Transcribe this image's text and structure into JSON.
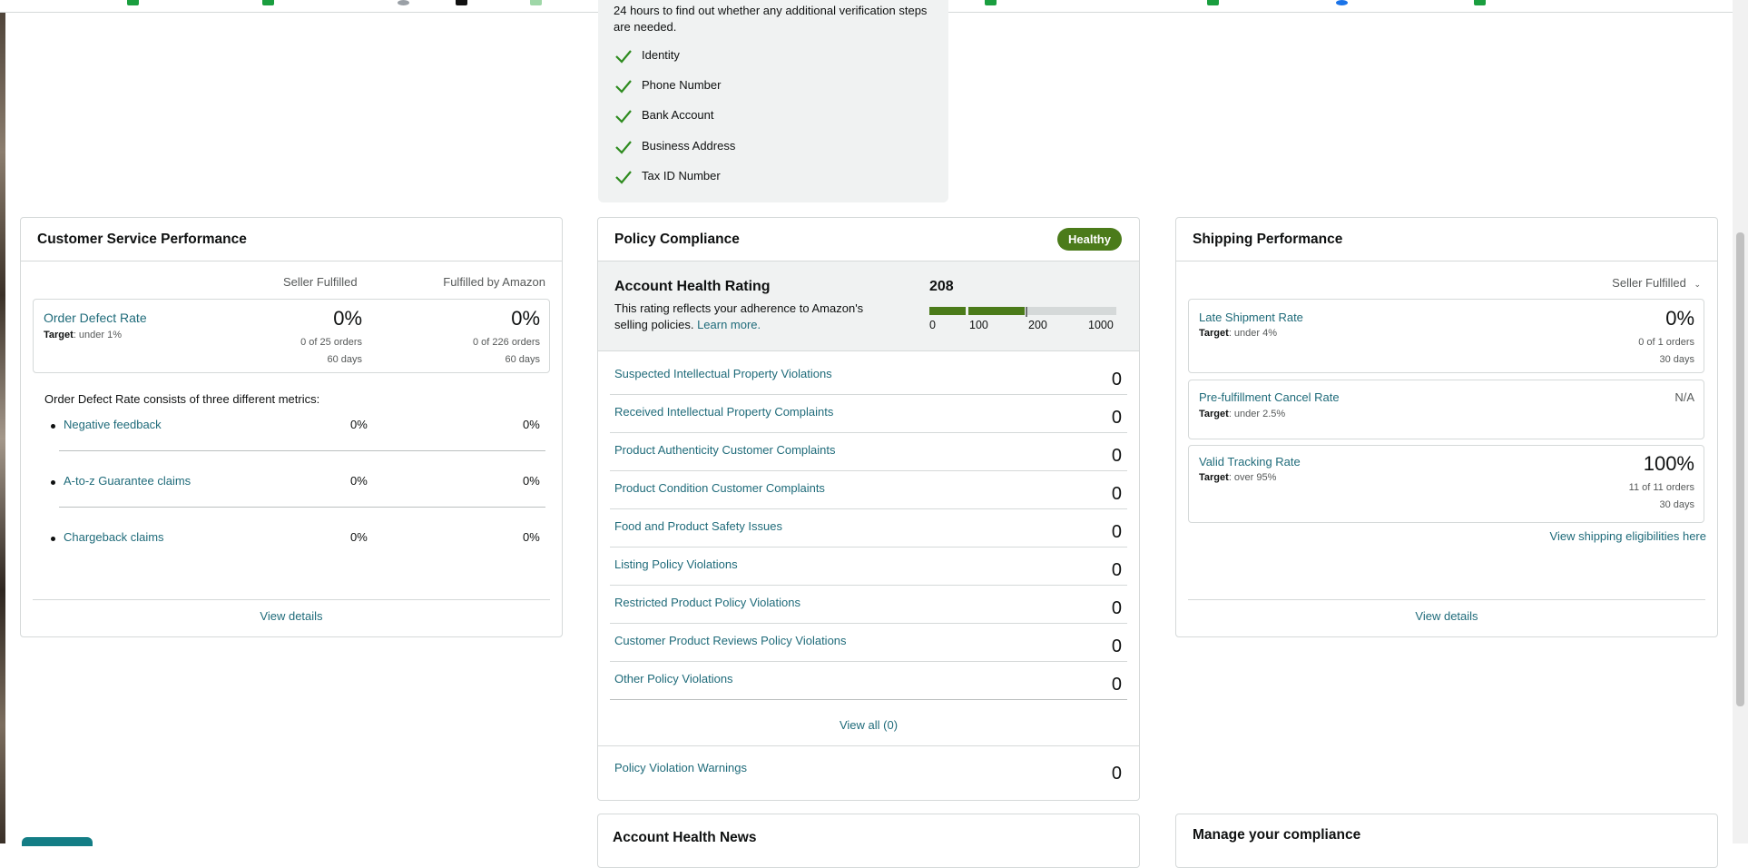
{
  "verification": {
    "intro": "24 hours to find out whether any additional verification steps are needed.",
    "items": [
      "Identity",
      "Phone Number",
      "Bank Account",
      "Business Address",
      "Tax ID Number"
    ],
    "check_color": "#2e8b1f"
  },
  "customer_service": {
    "title": "Customer Service Performance",
    "col_seller": "Seller Fulfilled",
    "col_fba": "Fulfilled by Amazon",
    "odr": {
      "label": "Order Defect Rate",
      "target_label": "Target",
      "target_value": ": under 1%",
      "seller_value": "0%",
      "seller_orders": "0 of 25 orders",
      "seller_period": "60 days",
      "fba_value": "0%",
      "fba_orders": "0 of 226 orders",
      "fba_period": "60 days"
    },
    "odr_intro": "Order Defect Rate consists of three different metrics:",
    "metrics": [
      {
        "label": "Negative feedback",
        "seller": "0%",
        "fba": "0%"
      },
      {
        "label": "A-to-z Guarantee claims",
        "seller": "0%",
        "fba": "0%"
      },
      {
        "label": "Chargeback claims",
        "seller": "0%",
        "fba": "0%"
      }
    ],
    "view_details": "View details"
  },
  "policy": {
    "title": "Policy Compliance",
    "badge": "Healthy",
    "badge_color": "#4b7b1a",
    "ahr_title": "Account Health Rating",
    "ahr_desc": "This rating reflects your adherence to Amazon's selling policies.",
    "learn_more": "Learn more.",
    "score": "208",
    "scale_labels": [
      "0",
      "100",
      "200",
      "1000"
    ],
    "violations": [
      {
        "label": "Suspected Intellectual Property Violations",
        "count": "0"
      },
      {
        "label": "Received Intellectual Property Complaints",
        "count": "0"
      },
      {
        "label": "Product Authenticity Customer Complaints",
        "count": "0"
      },
      {
        "label": "Product Condition Customer Complaints",
        "count": "0"
      },
      {
        "label": "Food and Product Safety Issues",
        "count": "0"
      },
      {
        "label": "Listing Policy Violations",
        "count": "0"
      },
      {
        "label": "Restricted Product Policy Violations",
        "count": "0"
      },
      {
        "label": "Customer Product Reviews Policy Violations",
        "count": "0"
      },
      {
        "label": "Other Policy Violations",
        "count": "0"
      }
    ],
    "view_all": "View all (0)",
    "warnings_label": "Policy Violation Warnings",
    "warnings_count": "0"
  },
  "shipping": {
    "title": "Shipping Performance",
    "filter": "Seller Fulfilled",
    "late": {
      "label": "Late Shipment Rate",
      "target_label": "Target",
      "target_value": ": under 4%",
      "value": "0%",
      "orders": "0 of 1 orders",
      "period": "30 days"
    },
    "cancel": {
      "label": "Pre-fulfillment Cancel Rate",
      "target_label": "Target",
      "target_value": ": under 2.5%",
      "value": "N/A"
    },
    "tracking": {
      "label": "Valid Tracking Rate",
      "target_label": "Target",
      "target_value": ": over 95%",
      "value": "100%",
      "orders": "11 of 11 orders",
      "period": "30 days"
    },
    "eligibilities": "View shipping eligibilities here",
    "view_details": "View details"
  },
  "bottom": {
    "news_title": "Account Health News",
    "manage_title": "Manage your compliance"
  }
}
